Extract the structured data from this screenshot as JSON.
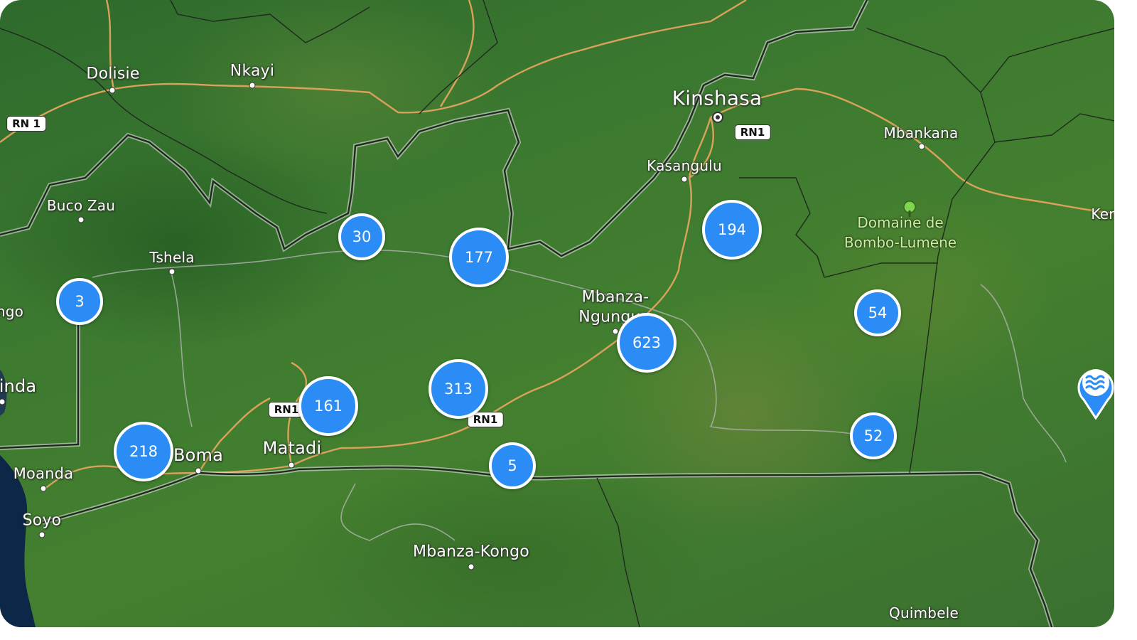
{
  "map": {
    "places": [
      {
        "id": "dolisie",
        "label": "Dolisie"
      },
      {
        "id": "nkayi",
        "label": "Nkayi"
      },
      {
        "id": "kinshasa",
        "label": "Kinshasa"
      },
      {
        "id": "mbankana",
        "label": "Mbankana"
      },
      {
        "id": "kasangulu",
        "label": "Kasangulu"
      },
      {
        "id": "buco-zau",
        "label": "Buco Zau"
      },
      {
        "id": "tshela",
        "label": "Tshela"
      },
      {
        "id": "mbanza-ngungu-1",
        "label": "Mbanza-"
      },
      {
        "id": "mbanza-ngungu-2",
        "label": "Ngungu"
      },
      {
        "id": "boma",
        "label": "Boma"
      },
      {
        "id": "matadi",
        "label": "Matadi"
      },
      {
        "id": "moanda",
        "label": "Moanda"
      },
      {
        "id": "soyo",
        "label": "Soyo"
      },
      {
        "id": "mbanza-kongo",
        "label": "Mbanza-Kongo"
      },
      {
        "id": "quimbele",
        "label": "Quimbele"
      },
      {
        "id": "ngo",
        "label": "ngo"
      },
      {
        "id": "inda",
        "label": "inda"
      },
      {
        "id": "ker",
        "label": "Ker"
      }
    ],
    "park": {
      "line1": "Domaine de",
      "line2": "Bombo-Lumene"
    },
    "road_shields": [
      "RN 1",
      "RN1",
      "RN1",
      "RN1"
    ],
    "clusters": [
      {
        "count": "30"
      },
      {
        "count": "177"
      },
      {
        "count": "194"
      },
      {
        "count": "3"
      },
      {
        "count": "54"
      },
      {
        "count": "623"
      },
      {
        "count": "313"
      },
      {
        "count": "161"
      },
      {
        "count": "218"
      },
      {
        "count": "52"
      },
      {
        "count": "5"
      }
    ],
    "pin": {
      "icon": "water-waves-icon",
      "color": "#2b8cf5"
    },
    "colors": {
      "cluster": "#2b8cf5",
      "road": "#d9a25a",
      "border": "#1f2a1f"
    }
  }
}
